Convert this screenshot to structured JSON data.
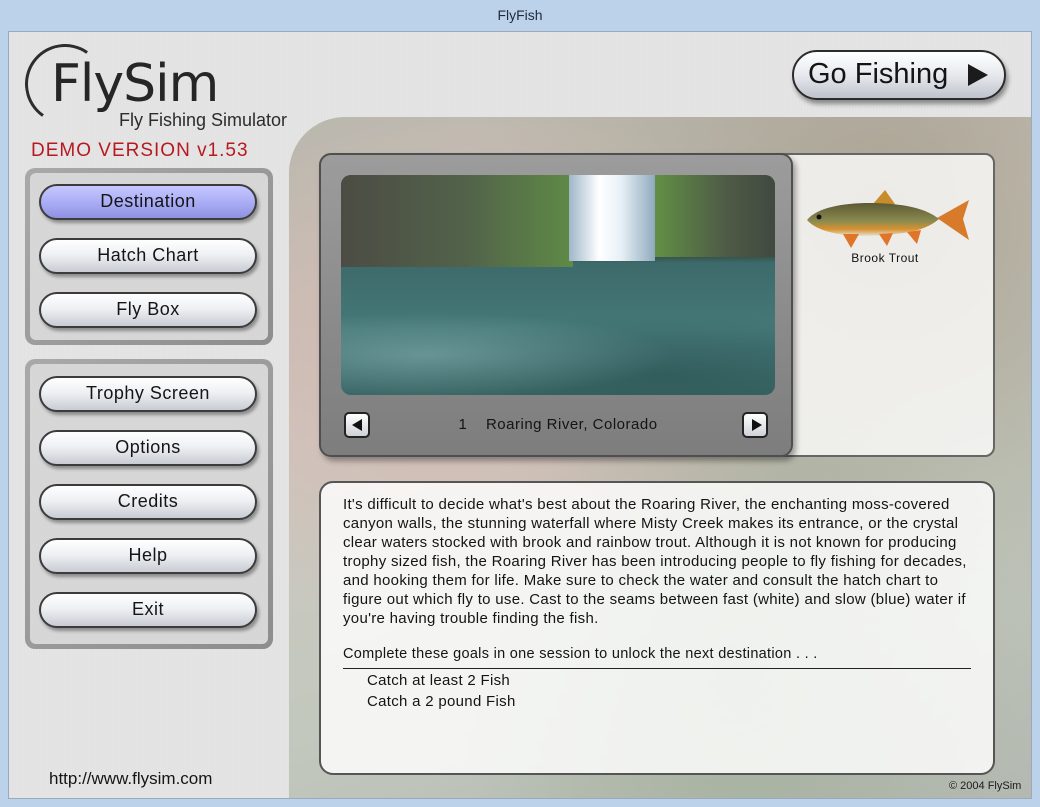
{
  "window": {
    "title": "FlyFish"
  },
  "logo": {
    "title": "FlySim",
    "subtitle": "Fly Fishing Simulator"
  },
  "version_label": "DEMO VERSION v1.53",
  "menu": {
    "primary": [
      {
        "label": "Destination",
        "active": true
      },
      {
        "label": "Hatch Chart",
        "active": false
      },
      {
        "label": "Fly Box",
        "active": false
      }
    ],
    "secondary": [
      {
        "label": "Trophy Screen"
      },
      {
        "label": "Options"
      },
      {
        "label": "Credits"
      },
      {
        "label": "Help"
      },
      {
        "label": "Exit"
      }
    ]
  },
  "website": "http://www.flysim.com",
  "go_button": {
    "label": "Go Fishing",
    "icon": "play-arrow-icon"
  },
  "destination": {
    "number": "1",
    "name": "Roaring River, Colorado",
    "prev_icon": "arrow-left-icon",
    "next_icon": "arrow-right-icon"
  },
  "fish": {
    "name": "Brook Trout"
  },
  "description": "It's difficult to decide what's best about the Roaring River, the enchanting moss-covered canyon walls, the stunning waterfall where Misty Creek makes its entrance, or the crystal clear waters stocked with brook and rainbow trout.  Although it is not known for producing trophy sized fish, the Roaring River has been introducing people to fly fishing for decades, and hooking them for life.  Make sure to check the water and consult the hatch chart to figure out which fly to use.  Cast to the seams between fast (white) and slow (blue) water if you're having trouble finding the fish.",
  "goals": {
    "title": "Complete these goals in one session to unlock the next destination . . .",
    "items": [
      "Catch at least 2 Fish",
      "Catch a 2 pound Fish"
    ]
  },
  "copyright": "© 2004 FlySim",
  "colors": {
    "demo_red": "#b8181f",
    "active_button": "#a8abf4"
  }
}
